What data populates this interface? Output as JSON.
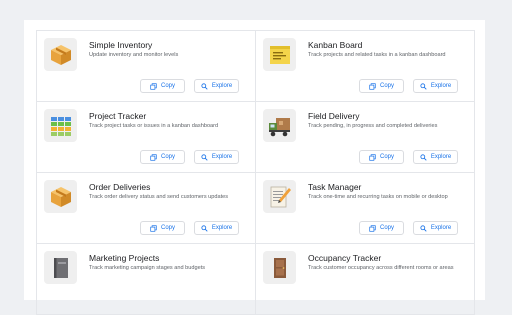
{
  "buttons": {
    "copy": "Copy",
    "explore": "Explore"
  },
  "templates": [
    {
      "title": "Simple Inventory",
      "description": "Update inventory and monitor levels",
      "icon": "cardboard-box-icon"
    },
    {
      "title": "Kanban Board",
      "description": "Track projects and related tasks in a kanban dashboard",
      "icon": "sticky-note-icon"
    },
    {
      "title": "Project Tracker",
      "description": "Track project tasks or issues in a kanban dashboard",
      "icon": "color-grid-icon"
    },
    {
      "title": "Field Delivery",
      "description": "Track pending, in progress and completed deliveries",
      "icon": "delivery-truck-icon"
    },
    {
      "title": "Order Deliveries",
      "description": "Track order delivery status and send customers updates",
      "icon": "cardboard-box-icon"
    },
    {
      "title": "Task Manager",
      "description": "Track one-time and recurring tasks on mobile or desktop",
      "icon": "notepad-pencil-icon"
    },
    {
      "title": "Marketing Projects",
      "description": "Track marketing campaign stages and budgets",
      "icon": "notebook-icon"
    },
    {
      "title": "Occupancy Tracker",
      "description": "Track customer occupancy across different rooms or areas",
      "icon": "door-icon"
    }
  ]
}
